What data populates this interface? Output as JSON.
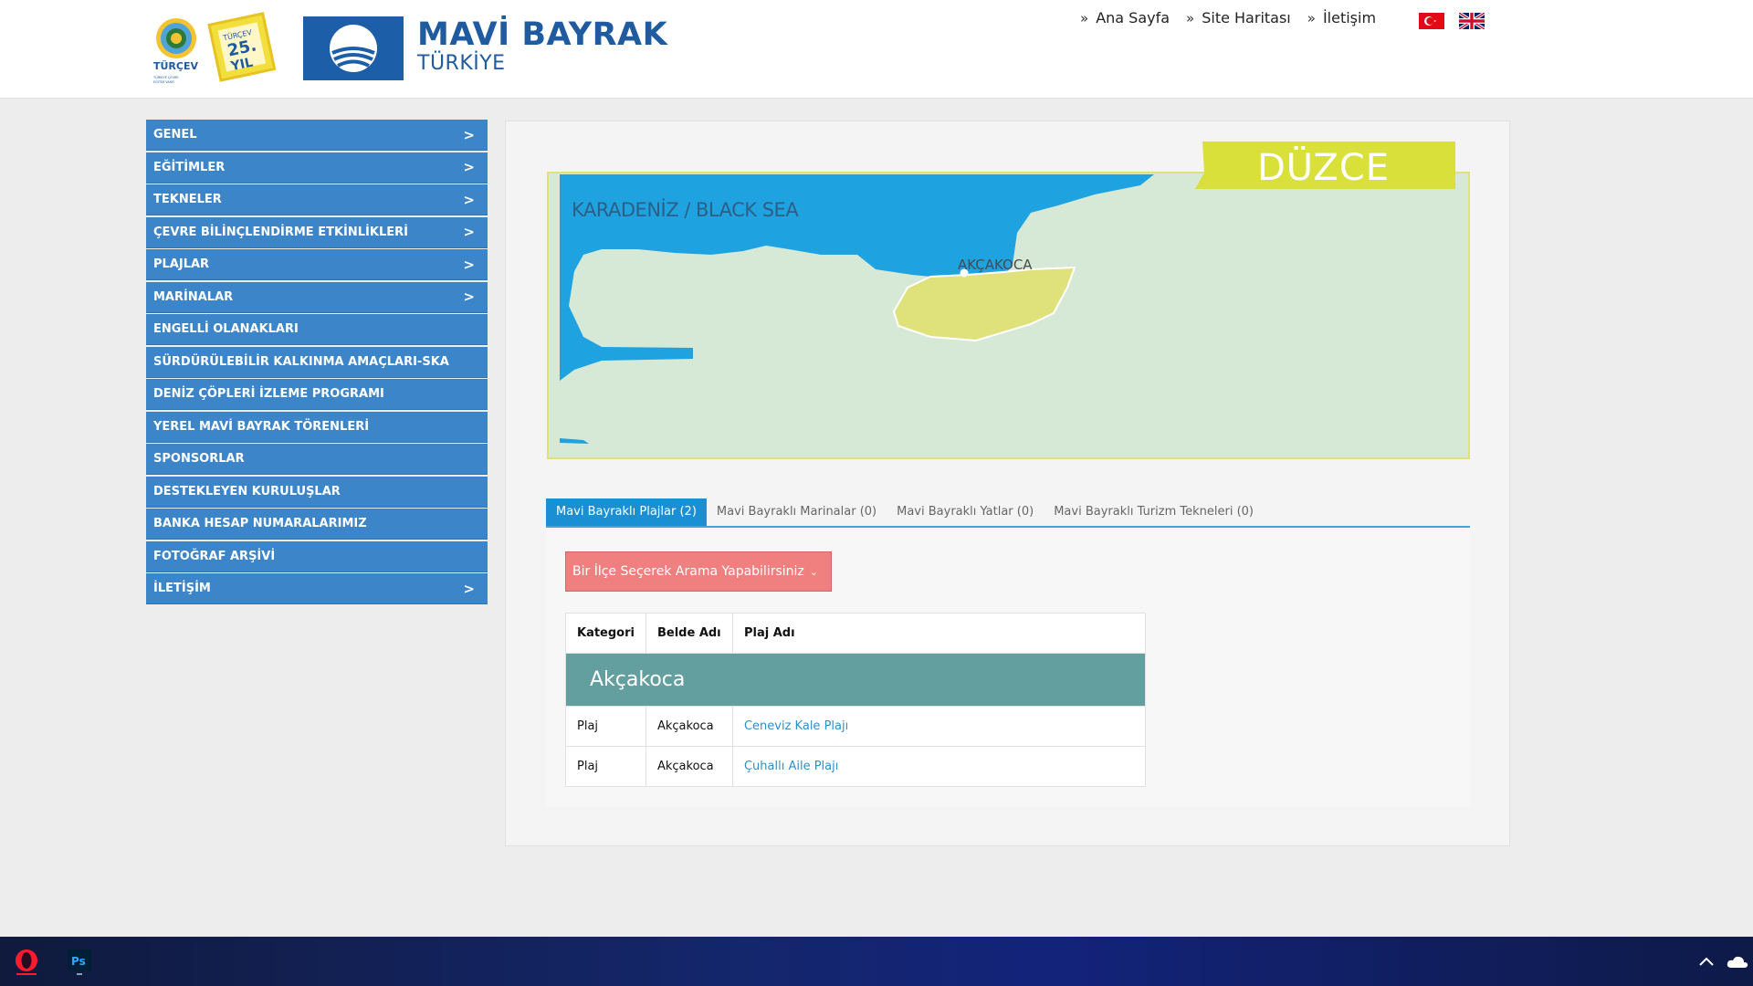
{
  "header": {
    "turcev_logo_text": "TÜRÇEV",
    "turcev_badge_text": "TÜRÇEV 25. YIL",
    "turcev_tagline": "TÜRKİYE ÇEVRE EĞİTİM VAKFI",
    "brand_title": "MAVİ BAYRAK",
    "brand_subtitle": "TÜRKİYE",
    "nav": [
      {
        "label": "Ana Sayfa"
      },
      {
        "label": "Site Haritası"
      },
      {
        "label": "İletişim"
      }
    ],
    "flags": [
      "turkey-flag-icon",
      "uk-flag-icon"
    ]
  },
  "sidebar": {
    "items": [
      {
        "label": "GENEL",
        "has_arrow": true
      },
      {
        "label": "EĞİTİMLER",
        "has_arrow": true
      },
      {
        "label": "TEKNELER",
        "has_arrow": true
      },
      {
        "label": "ÇEVRE BİLİNÇLENDİRME ETKİNLİKLERİ",
        "has_arrow": true
      },
      {
        "label": "PLAJLAR",
        "has_arrow": true
      },
      {
        "label": "MARİNALAR",
        "has_arrow": true
      },
      {
        "label": "ENGELLİ OLANAKLARI",
        "has_arrow": false
      },
      {
        "label": "SÜRDÜRÜLEBİLİR KALKINMA AMAÇLARI-SKA",
        "has_arrow": false
      },
      {
        "label": "DENİZ ÇÖPLERİ İZLEME PROGRAMI",
        "has_arrow": false
      },
      {
        "label": "YEREL MAVİ BAYRAK TÖRENLERİ",
        "has_arrow": false
      },
      {
        "label": "SPONSORLAR",
        "has_arrow": false
      },
      {
        "label": "DESTEKLEYEN KURULUŞLAR",
        "has_arrow": false
      },
      {
        "label": "BANKA HESAP NUMARALARIMIZ",
        "has_arrow": false
      },
      {
        "label": "FOTOĞRAF ARŞİVİ",
        "has_arrow": false
      },
      {
        "label": "İLETİŞİM",
        "has_arrow": true
      }
    ],
    "arrow_glyph": ">"
  },
  "map": {
    "province": "DÜZCE",
    "sea_label": "KARADENİZ / BLACK SEA",
    "town_label": "AKÇAKOCA",
    "colors": {
      "sea": "#1fa3e0",
      "land": "#d6e8d6",
      "district": "#dfe27b",
      "province_banner": "#d9e03a"
    }
  },
  "tabs": [
    {
      "label": "Mavi Bayraklı Plajlar (2)",
      "active": true
    },
    {
      "label": "Mavi Bayraklı Marinalar (0)",
      "active": false
    },
    {
      "label": "Mavi Bayraklı Yatlar (0)",
      "active": false
    },
    {
      "label": "Mavi Bayraklı Turizm Tekneleri (0)",
      "active": false
    }
  ],
  "filter": {
    "district_select_label": "Bir İlçe Seçerek Arama Yapabilirsiniz"
  },
  "table": {
    "columns": [
      "Kategori",
      "Belde Adı",
      "Plaj Adı"
    ],
    "group": "Akçakoca",
    "rows": [
      {
        "category": "Plaj",
        "town": "Akçakoca",
        "beach": "Ceneviz Kale Plajı"
      },
      {
        "category": "Plaj",
        "town": "Akçakoca",
        "beach": "Çuhallı Aile Plajı"
      }
    ]
  },
  "taskbar": {
    "apps": [
      "opera-icon",
      "photoshop-icon"
    ],
    "ps_label": "Ps",
    "tray": [
      "chevron-up-icon",
      "onedrive-cloud-icon"
    ]
  }
}
